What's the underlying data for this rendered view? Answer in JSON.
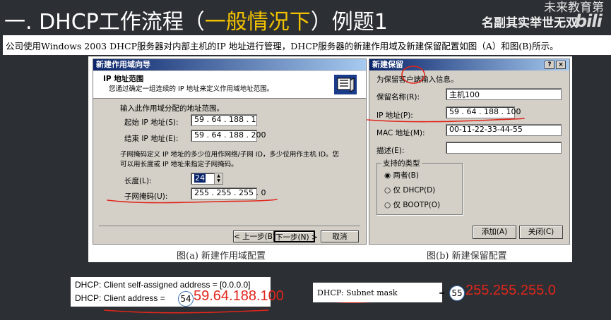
{
  "header": {
    "title_prefix": "一. DHCP工作流程（",
    "title_highlight": "一般情况下",
    "title_suffix": "）例题1",
    "brand_top": "未来教育第",
    "brand": "名副其实举世无双",
    "bili": "bili"
  },
  "description": "公司使用Windows 2003 DHCP服务器对内部主机的IP 地址进行管理，DHCP服务器的新建作用域及新建保留配置如图（A）和图(B)所示。",
  "wizard": {
    "title": "新建作用域向导",
    "heading": "IP 地址范围",
    "subheading": "您通过确定一组连续的 IP 地址来定义作用域地址范围。",
    "instruction": "输入此作用域分配的地址范围。",
    "start_label": "起始 IP 地址(S):",
    "start_value": "59 . 64 . 188 . 1",
    "end_label": "结束 IP 地址(E):",
    "end_value": "59 . 64 . 188 . 200",
    "mask_desc_1": "子网掩码定义 IP 地址的多少位用作网络/子网 ID，多少位用作主机 ID。您",
    "mask_desc_2": "可以用长度或 IP 地址来指定子网掩码。",
    "length_label": "长度(L):",
    "length_value": "24",
    "mask_label": "子网掩码(U):",
    "mask_value": "255 . 255 . 255 . 0",
    "back_button": "< 上一步(B)",
    "next_button": "下一步(N) >",
    "cancel_button": "取消"
  },
  "reservation": {
    "title": "新建保留",
    "help_button": "?",
    "close_button": "×",
    "prompt": "为保留客户端输入信息。",
    "name_label": "保留名称(R):",
    "name_value": "主机100",
    "ip_label": "IP 地址(P):",
    "ip_value": "59 . 64 . 188 . 100",
    "mac_label": "MAC 地址(M):",
    "mac_value": "00-11-22-33-44-55",
    "desc_label": "描述(E):",
    "desc_value": "",
    "group_label": "支持的类型",
    "options": [
      "两者(B)",
      "仅 DHCP(D)",
      "仅 BOOTP(O)"
    ],
    "selected_option": 0,
    "add_button": "添加(A)",
    "close_text_button": "关闭(C)"
  },
  "captions": {
    "a": "图(a)  新建作用域配置",
    "b": "图(b)  新建保留配置"
  },
  "bottom_left": {
    "line1": "DHCP: Client self-assigned address  = [0.0.0.0]",
    "line2_prefix": "DHCP: Client address   = ",
    "circle_number": "54",
    "answer": "59.64.188.100"
  },
  "bottom_right": {
    "label": "DHCP: Subnet mask",
    "equals": "=",
    "circle_number": "55",
    "answer": "255.255.255.0"
  }
}
